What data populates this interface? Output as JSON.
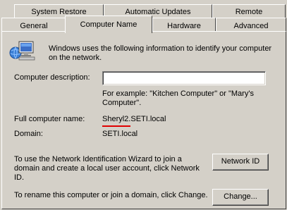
{
  "tabs": {
    "row1": [
      "System Restore",
      "Automatic Updates",
      "Remote"
    ],
    "row2": [
      "General",
      "Computer Name",
      "Hardware",
      "Advanced"
    ],
    "active": "Computer Name"
  },
  "info_text": "Windows uses the following information to identify your computer on the network.",
  "description_label": "Computer description:",
  "description_value": "",
  "example_text": "For example: \"Kitchen Computer\" or \"Mary's Computer\".",
  "full_name_label": "Full computer name:",
  "full_name_value": "Sheryl2.SETI.local",
  "domain_label": "Domain:",
  "domain_value": "SETI.local",
  "wizard_text": "To use the Network Identification Wizard to join a domain and create a local user account, click Network ID.",
  "network_id_button": "Network ID",
  "rename_text": "To rename this computer or join a domain, click Change.",
  "change_button": "Change...",
  "colors": {
    "dialog_bg": "#d4d0c8",
    "annotation_underline": "#e00000"
  },
  "icons": [
    "computer-network-icon"
  ]
}
